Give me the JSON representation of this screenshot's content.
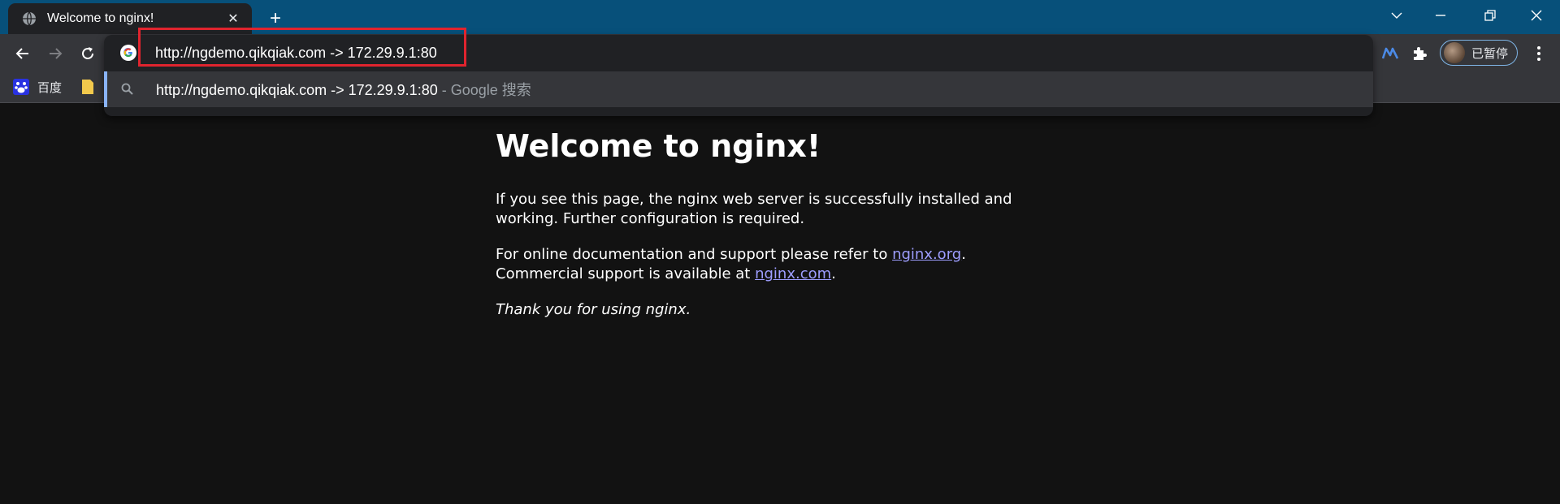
{
  "tab": {
    "title": "Welcome to nginx!"
  },
  "omnibox": {
    "text": "http://ngdemo.qikqiak.com -> 172.29.9.1:80"
  },
  "suggestion": {
    "query": "http://ngdemo.qikqiak.com -> 172.29.9.1:80",
    "suffix": " - Google 搜索"
  },
  "bookmarks": [
    {
      "label": "百度"
    }
  ],
  "profile": {
    "label": "已暂停"
  },
  "page": {
    "heading": "Welcome to nginx!",
    "p1": "If you see this page, the nginx web server is successfully installed and working. Further configuration is required.",
    "p2_pre": "For online documentation and support please refer to ",
    "link1": "nginx.org",
    "p2_mid": ".",
    "p2_line2": "Commercial support is available at ",
    "link2": "nginx.com",
    "p2_end": ".",
    "p3": "Thank you for using nginx."
  },
  "colors": {
    "tabstrip": "#07507a",
    "toolbar": "#35363a",
    "omnibox": "#202124",
    "highlight": "#e0242e",
    "link": "#9e9eff",
    "page_bg": "#121212"
  },
  "icons": [
    "globe-icon",
    "close-icon",
    "plus-icon",
    "chevron-down-icon",
    "minimize-icon",
    "restore-icon",
    "window-close-icon",
    "back-icon",
    "forward-icon",
    "reload-icon",
    "google-icon",
    "search-icon",
    "baidu-icon",
    "folder-icon",
    "extension-m-icon",
    "puzzle-icon",
    "kebab-menu-icon"
  ]
}
